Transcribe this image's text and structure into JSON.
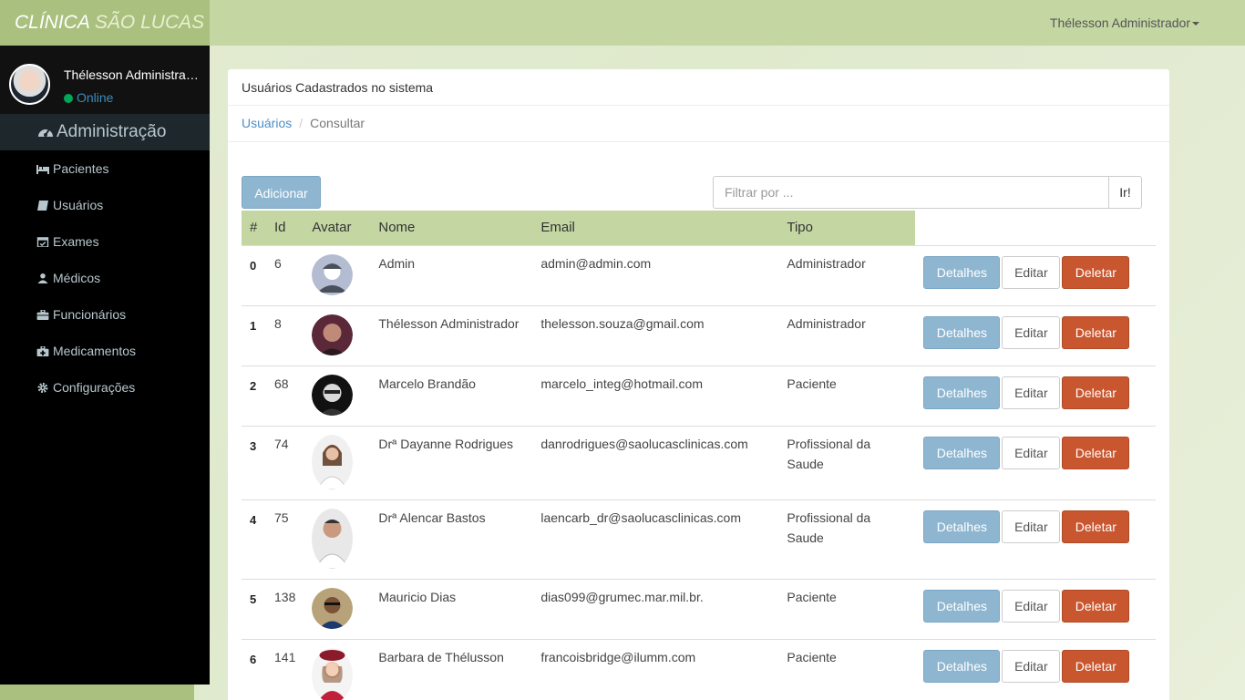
{
  "brand": {
    "part1": "CLÍNICA",
    "part2": "SÃO LUCAS"
  },
  "topbar": {
    "user": "Thélesson Administrador"
  },
  "sidebar": {
    "user_name": "Thélesson Administrador",
    "status": "Online",
    "header": "Administração",
    "items": [
      {
        "label": "Pacientes",
        "icon": "bed-icon"
      },
      {
        "label": "Usuários",
        "icon": "book-icon"
      },
      {
        "label": "Exames",
        "icon": "calendar-check-icon"
      },
      {
        "label": "Médicos",
        "icon": "doctor-icon"
      },
      {
        "label": "Funcionários",
        "icon": "briefcase-icon"
      },
      {
        "label": "Medicamentos",
        "icon": "medkit-icon"
      },
      {
        "label": "Configurações",
        "icon": "gear-icon"
      }
    ]
  },
  "panel": {
    "title": "Usuários Cadastrados no sistema",
    "breadcrumb": {
      "link": "Usuários",
      "current": "Consultar"
    },
    "add_label": "Adicionar",
    "filter_placeholder": "Filtrar por ...",
    "go_label": "Ir!"
  },
  "table": {
    "headers": [
      "#",
      "Id",
      "Avatar",
      "Nome",
      "Email",
      "Tipo"
    ],
    "actions": {
      "details": "Detalhes",
      "edit": "Editar",
      "delete": "Deletar"
    },
    "rows": [
      {
        "idx": "0",
        "id": "6",
        "name": "Admin",
        "email": "admin@admin.com",
        "tipo": "Administrador"
      },
      {
        "idx": "1",
        "id": "8",
        "name": "Thélesson Administrador",
        "email": "thelesson.souza@gmail.com",
        "tipo": "Administrador"
      },
      {
        "idx": "2",
        "id": "68",
        "name": "Marcelo Brandão",
        "email": "marcelo_integ@hotmail.com",
        "tipo": "Paciente"
      },
      {
        "idx": "3",
        "id": "74",
        "name": "Drª Dayanne Rodrigues",
        "email": "danrodrigues@saolucasclinicas.com",
        "tipo": "Profissional da Saude"
      },
      {
        "idx": "4",
        "id": "75",
        "name": "Drª Alencar Bastos",
        "email": "laencarb_dr@saolucasclinicas.com",
        "tipo": "Profissional da Saude"
      },
      {
        "idx": "5",
        "id": "138",
        "name": "Mauricio Dias",
        "email": "dias099@grumec.mar.mil.br.",
        "tipo": "Paciente"
      },
      {
        "idx": "6",
        "id": "141",
        "name": "Barbara de Thélusson",
        "email": "francoisbridge@ilumm.com",
        "tipo": "Paciente"
      }
    ]
  }
}
